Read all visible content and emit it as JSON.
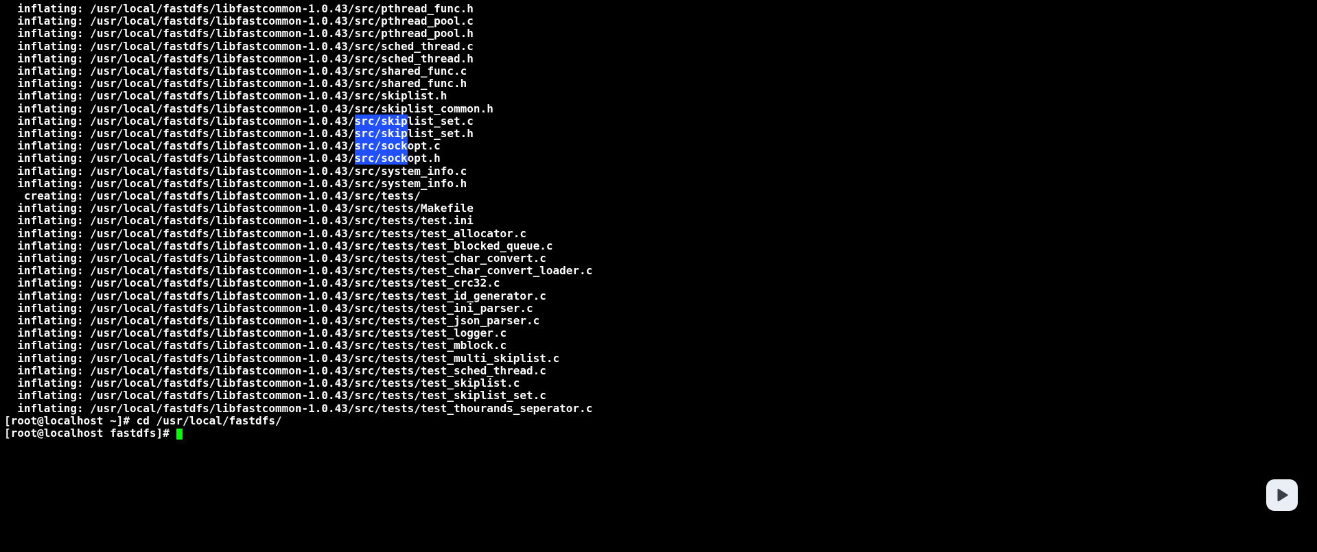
{
  "terminal": {
    "base_path": "/usr/local/fastdfs/libfastcommon-1.0.43/src/",
    "lines": [
      {
        "action": "inflating:",
        "file": "pthread_func.h"
      },
      {
        "action": "inflating:",
        "file": "pthread_pool.c"
      },
      {
        "action": "inflating:",
        "file": "pthread_pool.h"
      },
      {
        "action": "inflating:",
        "file": "sched_thread.c"
      },
      {
        "action": "inflating:",
        "file": "sched_thread.h"
      },
      {
        "action": "inflating:",
        "file": "shared_func.c"
      },
      {
        "action": "inflating:",
        "file": "shared_func.h"
      },
      {
        "action": "inflating:",
        "file": "skiplist.h"
      },
      {
        "action": "inflating:",
        "file": "skiplist_common.h"
      },
      {
        "action": "inflating:",
        "file": "skiplist_set.c",
        "sel": true
      },
      {
        "action": "inflating:",
        "file": "skiplist_set.h",
        "sel": true
      },
      {
        "action": "inflating:",
        "file": "sockopt.c",
        "sel": true
      },
      {
        "action": "inflating:",
        "file": "sockopt.h",
        "sel": true
      },
      {
        "action": "inflating:",
        "file": "system_info.c"
      },
      {
        "action": "inflating:",
        "file": "system_info.h"
      },
      {
        "action": " creating:",
        "file": "tests/"
      },
      {
        "action": "inflating:",
        "file": "tests/Makefile"
      },
      {
        "action": "inflating:",
        "file": "tests/test.ini"
      },
      {
        "action": "inflating:",
        "file": "tests/test_allocator.c"
      },
      {
        "action": "inflating:",
        "file": "tests/test_blocked_queue.c"
      },
      {
        "action": "inflating:",
        "file": "tests/test_char_convert.c"
      },
      {
        "action": "inflating:",
        "file": "tests/test_char_convert_loader.c"
      },
      {
        "action": "inflating:",
        "file": "tests/test_crc32.c"
      },
      {
        "action": "inflating:",
        "file": "tests/test_id_generator.c"
      },
      {
        "action": "inflating:",
        "file": "tests/test_ini_parser.c"
      },
      {
        "action": "inflating:",
        "file": "tests/test_json_parser.c"
      },
      {
        "action": "inflating:",
        "file": "tests/test_logger.c"
      },
      {
        "action": "inflating:",
        "file": "tests/test_mblock.c"
      },
      {
        "action": "inflating:",
        "file": "tests/test_multi_skiplist.c"
      },
      {
        "action": "inflating:",
        "file": "tests/test_sched_thread.c"
      },
      {
        "action": "inflating:",
        "file": "tests/test_skiplist.c"
      },
      {
        "action": "inflating:",
        "file": "tests/test_skiplist_set.c"
      },
      {
        "action": "inflating:",
        "file": "tests/test_thourands_seperator.c"
      }
    ],
    "prompts": [
      {
        "prompt": "[root@localhost ~]# ",
        "cmd": "cd /usr/local/fastdfs/"
      },
      {
        "prompt": "[root@localhost fastdfs]# ",
        "cmd": "",
        "cursor": true
      }
    ],
    "selection_prefix": "src/",
    "selection_chars": 8
  }
}
